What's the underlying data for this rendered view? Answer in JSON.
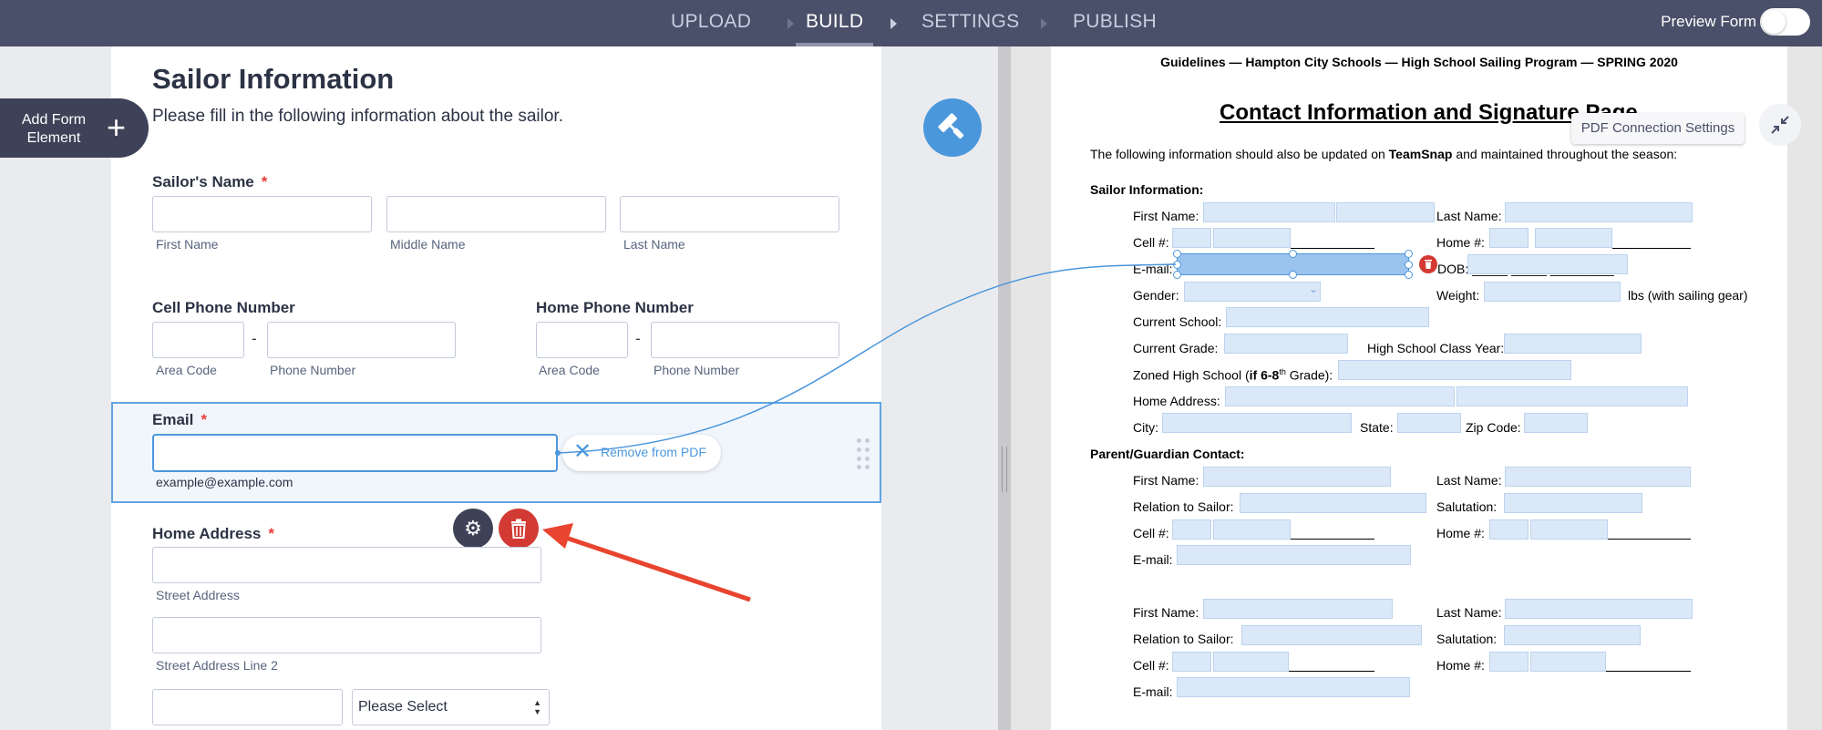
{
  "topbar": {
    "steps": [
      "UPLOAD",
      "BUILD",
      "SETTINGS",
      "PUBLISH"
    ],
    "active_step": "BUILD",
    "preview_label": "Preview Form",
    "preview_enabled": false
  },
  "sidebar": {
    "add_element_label": "Add Form Element"
  },
  "form": {
    "title": "Sailor Information",
    "subtitle": "Please fill in the following information about the sailor.",
    "sailor_name": {
      "label": "Sailor's Name",
      "required": "*",
      "first": "First Name",
      "middle": "Middle Name",
      "last": "Last Name"
    },
    "cell_phone": {
      "label": "Cell Phone Number",
      "area": "Area Code",
      "number": "Phone Number",
      "dash": "-"
    },
    "home_phone": {
      "label": "Home Phone Number",
      "area": "Area Code",
      "number": "Phone Number",
      "dash": "-"
    },
    "email": {
      "label": "Email",
      "required": "*",
      "hint": "example@example.com",
      "remove_label": "Remove from PDF"
    },
    "home_address": {
      "label": "Home Address",
      "required": "*",
      "street": "Street Address",
      "street2": "Street Address Line 2",
      "state_select": "Please Select"
    }
  },
  "pdf": {
    "header": "Guidelines — Hampton City Schools — High School Sailing Program — SPRING 2020",
    "title": "Contact Information and Signature Page",
    "intro_pre": "The following information should also be updated on ",
    "intro_bold": "TeamSnap",
    "intro_post": " and maintained throughout the season:",
    "sailor_section": "Sailor Information:",
    "first_name": "First Name:",
    "last_name": "Last Name:",
    "cell": "Cell #:",
    "home": "Home #:",
    "email": "E-mail:",
    "dob": "DOB: _____/_____/_________",
    "gender": "Gender:",
    "weight": "Weight:",
    "weight_suffix": "lbs (with sailing gear)",
    "current_school": "Current School:",
    "current_grade": "Current Grade:",
    "class_year": "High School Class Year:",
    "zoned_pre": "Zoned High School (",
    "zoned_bold": "if 6-8",
    "zoned_sup": "th",
    "zoned_post": " Grade):",
    "home_address": "Home Address:",
    "city": "City:",
    "state": "State:",
    "zip": "Zip Code:",
    "parent_section": "Parent/Guardian Contact:",
    "relation": "Relation to Sailor:",
    "salutation": "Salutation:",
    "connection_settings": "PDF Connection Settings"
  },
  "colors": {
    "topbar": "#4a5069",
    "accent": "#4b97dc",
    "danger": "#d33a33",
    "arrow": "#e8442f"
  }
}
